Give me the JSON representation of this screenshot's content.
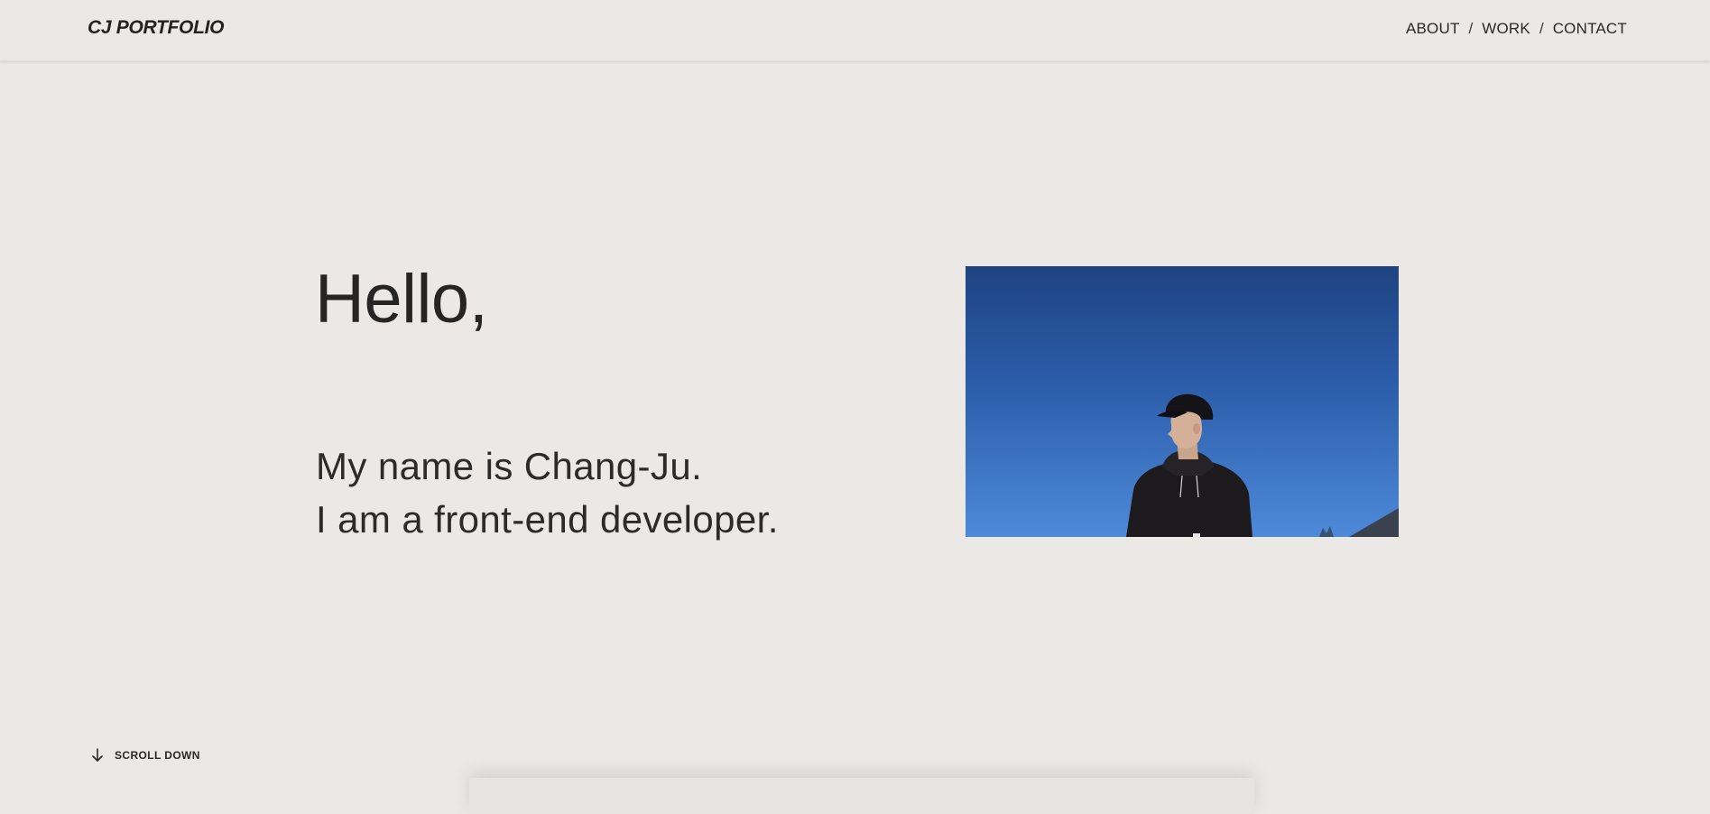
{
  "header": {
    "logo": "CJ PORTFOLIO",
    "nav": [
      {
        "label": "ABOUT"
      },
      {
        "label": "WORK"
      },
      {
        "label": "CONTACT"
      }
    ],
    "separator": "/"
  },
  "hero": {
    "title": "Hello,",
    "intro_lines": [
      "My name is Chang-Ju.",
      "I am a front-end developer."
    ],
    "photo_icon": "portrait-photo"
  },
  "scroll": {
    "label": "SCROLL DOWN",
    "icon": "arrow-down-icon"
  },
  "colors": {
    "background": "#ebe8e5",
    "text": "#2a2928",
    "sky": "#2a5aa6"
  }
}
